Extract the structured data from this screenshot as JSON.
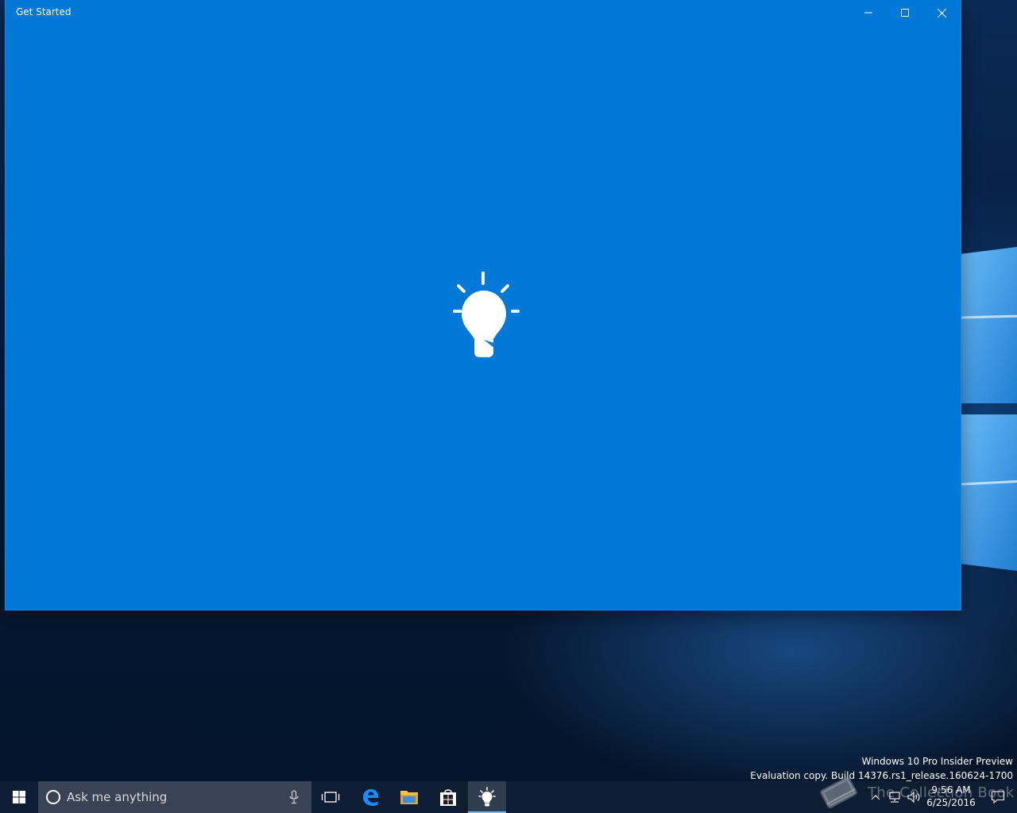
{
  "window": {
    "title": "Get Started",
    "background_color": "#0078d7",
    "buttons": {
      "minimize_icon": "minimize-icon",
      "maximize_icon": "maximize-icon",
      "close_icon": "close-icon"
    },
    "splash_icon": "lightbulb-icon"
  },
  "watermark": {
    "line1": "Windows 10 Pro Insider Preview",
    "line2": "Evaluation copy. Build 14376.rs1_release.160624-1700"
  },
  "overlay_watermark": {
    "text": "The Collection Book",
    "icon": "book-icon"
  },
  "taskbar": {
    "search_placeholder": "Ask me anything",
    "pinned": [
      {
        "name": "Task View",
        "icon": "task-view-icon"
      },
      {
        "name": "Microsoft Edge",
        "icon": "edge-icon"
      },
      {
        "name": "File Explorer",
        "icon": "file-explorer-icon"
      },
      {
        "name": "Store",
        "icon": "store-icon"
      },
      {
        "name": "Get Started",
        "icon": "lightbulb-icon",
        "active": true
      }
    ],
    "clock": {
      "time": "9:56 AM",
      "date": "6/25/2016"
    },
    "accent_color": "#76b9ed"
  }
}
